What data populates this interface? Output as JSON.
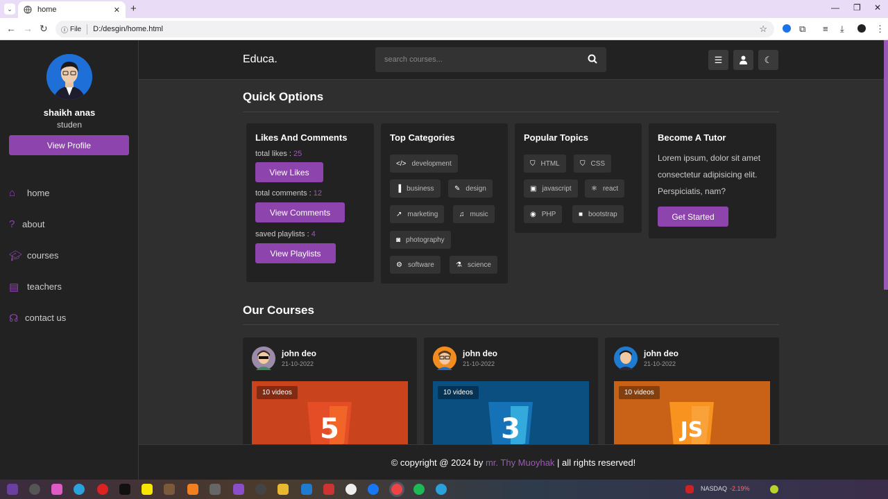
{
  "browser": {
    "tab_title": "home",
    "url_chip": "File",
    "url": "D:/desgin/home.html"
  },
  "sidebar": {
    "name": "shaikh anas",
    "role": "studen",
    "view_profile": "View Profile",
    "items": [
      {
        "label": "home",
        "icon": "home-icon"
      },
      {
        "label": "about",
        "icon": "question-icon"
      },
      {
        "label": "courses",
        "icon": "graduation-cap-icon"
      },
      {
        "label": "teachers",
        "icon": "chalkboard-teacher-icon"
      },
      {
        "label": "contact us",
        "icon": "headset-icon"
      }
    ]
  },
  "header": {
    "logo": "Educa.",
    "search_placeholder": "search courses..."
  },
  "quick": {
    "title": "Quick Options",
    "likes": {
      "title": "Likes And Comments",
      "likes_label": "total likes : ",
      "likes_value": "25",
      "view_likes": "View Likes",
      "comments_label": "total comments : ",
      "comments_value": "12",
      "view_comments": "View Comments",
      "playlists_label": "saved playlists : ",
      "playlists_value": "4",
      "view_playlists": "View Playlists"
    },
    "categories": {
      "title": "Top Categories",
      "tags": [
        "development",
        "business",
        "design",
        "marketing",
        "music",
        "photography",
        "software",
        "science"
      ]
    },
    "topics": {
      "title": "Popular Topics",
      "tags": [
        "HTML",
        "CSS",
        "javascript",
        "react",
        "PHP",
        "bootstrap"
      ]
    },
    "tutor": {
      "title": "Become A Tutor",
      "text": "Lorem ipsum, dolor sit amet consectetur adipisicing elit. Perspiciatis, nam?",
      "button": "Get Started"
    }
  },
  "courses": {
    "title": "Our Courses",
    "cards": [
      {
        "name": "john deo",
        "date": "21-10-2022",
        "videos": "10 videos",
        "color": "#c9431d",
        "logo": "5"
      },
      {
        "name": "john deo",
        "date": "21-10-2022",
        "videos": "10 videos",
        "color": "#0a4f80",
        "logo": "3"
      },
      {
        "name": "john deo",
        "date": "21-10-2022",
        "videos": "10 videos",
        "color": "#c96116",
        "logo": "JS"
      }
    ]
  },
  "footer": {
    "prefix": "© copyright @ 2024 by ",
    "author": "mr. Thy Muoyhak",
    "suffix": " | all rights reserved!"
  },
  "taskbar": {
    "ticker": "NASDAQ",
    "change": "-2.19%"
  }
}
